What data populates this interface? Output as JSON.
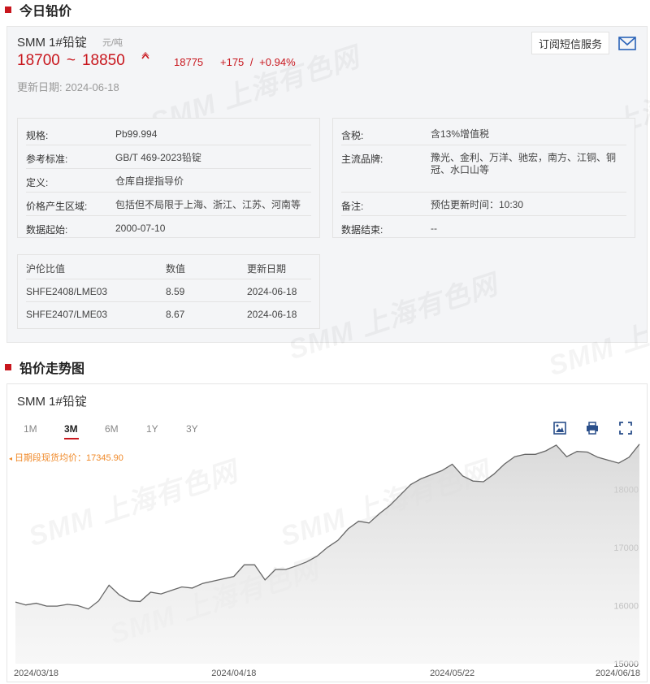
{
  "section1": {
    "title": "今日铅价"
  },
  "section2": {
    "title": "铅价走势图"
  },
  "watermark": "SMM 上海有色网",
  "product": {
    "name": "SMM 1#铅锭",
    "unit": "元/吨",
    "price_low": "18700",
    "tilde": "~",
    "price_high": "18850",
    "avg": "18775",
    "change": "+175",
    "sep": "/",
    "change_pct": "+0.94%",
    "update_label": "更新日期:",
    "update_date": "2024-06-18"
  },
  "subscribe": {
    "label": "订阅短信服务"
  },
  "spec_left": [
    {
      "k": "规格:",
      "v": "Pb99.994"
    },
    {
      "k": "参考标准:",
      "v": "GB/T 469-2023铅锭"
    },
    {
      "k": "定义:",
      "v": "仓库自提指导价"
    },
    {
      "k": "价格产生区域:",
      "v": "包括但不局限于上海、浙江、江苏、河南等"
    },
    {
      "k": "数据起始:",
      "v": "2000-07-10"
    }
  ],
  "spec_right": [
    {
      "k": "含税:",
      "v": "含13%增值税"
    },
    {
      "k": "主流品牌:",
      "v": "豫光、金利、万洋、驰宏，南方、江铜、铜冠、水口山等"
    },
    {
      "k": "备注:",
      "v": "预估更新时间：10:30"
    },
    {
      "k": "数据结束:",
      "v": "--"
    }
  ],
  "ratio_table": {
    "headers": [
      "沪伦比值",
      "数值",
      "更新日期"
    ],
    "rows": [
      [
        "SHFE2408/LME03",
        "8.59",
        "2024-06-18"
      ],
      [
        "SHFE2407/LME03",
        "8.67",
        "2024-06-18"
      ]
    ]
  },
  "chart": {
    "title": "SMM 1#铅锭",
    "tabs": [
      "1M",
      "3M",
      "6M",
      "1Y",
      "3Y"
    ],
    "active_tab": "3M",
    "avg_label": "日期段现货均价：17345.90"
  },
  "colors": {
    "accent": "#c8161d",
    "avg": "#f08a2a",
    "line": "#666666"
  },
  "chart_data": {
    "type": "area",
    "ylim": [
      15000,
      18800
    ],
    "y_ticks": [
      15000,
      16000,
      17000,
      18000
    ],
    "x_tick_labels": [
      "2024/03/18",
      "2024/04/18",
      "2024/05/22",
      "2024/06/18"
    ],
    "x": [
      "2024-03-18",
      "2024-03-19",
      "2024-03-20",
      "2024-03-21",
      "2024-03-22",
      "2024-03-25",
      "2024-03-26",
      "2024-03-27",
      "2024-03-28",
      "2024-03-29",
      "2024-04-01",
      "2024-04-02",
      "2024-04-03",
      "2024-04-08",
      "2024-04-09",
      "2024-04-10",
      "2024-04-11",
      "2024-04-12",
      "2024-04-15",
      "2024-04-16",
      "2024-04-17",
      "2024-04-18",
      "2024-04-19",
      "2024-04-22",
      "2024-04-23",
      "2024-04-24",
      "2024-04-25",
      "2024-04-26",
      "2024-04-29",
      "2024-04-30",
      "2024-05-06",
      "2024-05-07",
      "2024-05-08",
      "2024-05-09",
      "2024-05-10",
      "2024-05-13",
      "2024-05-14",
      "2024-05-15",
      "2024-05-16",
      "2024-05-17",
      "2024-05-20",
      "2024-05-21",
      "2024-05-22",
      "2024-05-23",
      "2024-05-24",
      "2024-05-27",
      "2024-05-28",
      "2024-05-29",
      "2024-05-30",
      "2024-05-31",
      "2024-06-03",
      "2024-06-04",
      "2024-06-05",
      "2024-06-06",
      "2024-06-07",
      "2024-06-11",
      "2024-06-12",
      "2024-06-13",
      "2024-06-14",
      "2024-06-17",
      "2024-06-18"
    ],
    "series": [
      {
        "values": [
          16060,
          16010,
          16040,
          15990,
          15990,
          16020,
          16000,
          15940,
          16080,
          16350,
          16180,
          16080,
          16070,
          16230,
          16200,
          16260,
          16320,
          16300,
          16380,
          16420,
          16460,
          16500,
          16700,
          16700,
          16440,
          16620,
          16620,
          16680,
          16750,
          16850,
          17000,
          17120,
          17320,
          17450,
          17420,
          17580,
          17720,
          17900,
          18080,
          18180,
          18250,
          18320,
          18430,
          18230,
          18140,
          18130,
          18260,
          18430,
          18560,
          18600,
          18600,
          18660,
          18760,
          18560,
          18650,
          18640,
          18550,
          18500,
          18450,
          18550,
          18775
        ]
      }
    ]
  }
}
